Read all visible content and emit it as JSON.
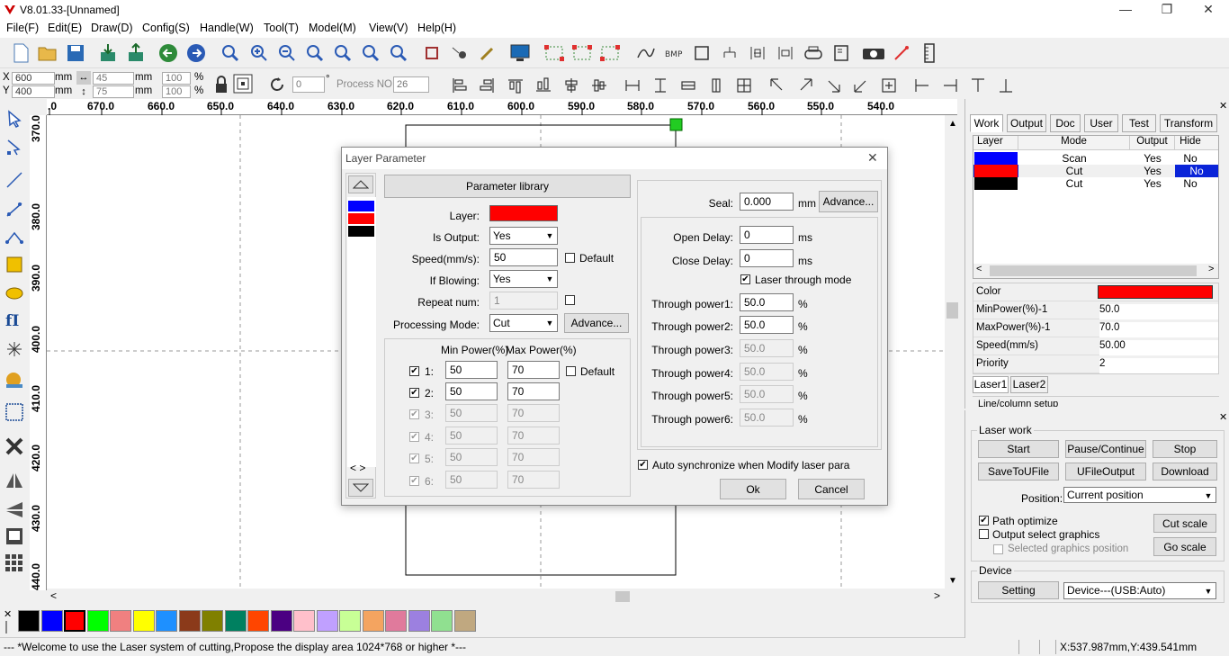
{
  "window": {
    "title": "V8.01.33-[Unnamed]",
    "min": "—",
    "max": "❐",
    "close": "✕"
  },
  "menu": [
    "File(F)",
    "Edit(E)",
    "Draw(D)",
    "Config(S)",
    "Handle(W)",
    "Tool(T)",
    "Model(M)",
    "View(V)",
    "Help(H)"
  ],
  "props": {
    "x": "600",
    "y": "400",
    "w": "45",
    "h": "75",
    "unit": "mm",
    "pw": "100",
    "ph": "100",
    "pct": "%",
    "rot": "0",
    "deg": "°",
    "procno_label": "Process NO:",
    "procno": "26"
  },
  "ruler_top": [
    "670.0",
    "660.0",
    "650.0",
    "640.0",
    "630.0",
    "620.0",
    "610.0",
    "600.0",
    "590.0",
    "580.0",
    "570.0",
    "560.0",
    "550.0",
    "540.0"
  ],
  "ruler_top_first": ".0",
  "ruler_left": [
    "370.0",
    "380.0",
    "390.0",
    "400.0",
    "410.0",
    "420.0",
    "430.0",
    "440.0"
  ],
  "palette": [
    "#000000",
    "#0000ff",
    "#ff0000",
    "#00ff00",
    "#f08080",
    "#ffff00",
    "#1e90ff",
    "#8b3a1a",
    "#808000",
    "#008060",
    "#ff4500",
    "#4b0082",
    "#ffc0cb",
    "#c0a0ff",
    "#c8ff96",
    "#f4a460",
    "#e07a9c",
    "#9c80e0",
    "#90e090",
    "#c0a880"
  ],
  "status": {
    "message": "--- *Welcome to use the Laser system of cutting,Propose the display area 1024*768 or higher *---",
    "coords": "X:537.987mm,Y:439.541mm"
  },
  "rpanel": {
    "tabs": [
      "Work",
      "Output",
      "Doc",
      "User",
      "Test",
      "Transform"
    ],
    "headers": [
      "Layer",
      "Mode",
      "Output",
      "Hide"
    ],
    "layers": [
      {
        "color": "#0000ff",
        "mode": "Scan",
        "output": "Yes",
        "hide": "No"
      },
      {
        "color": "#ff0000",
        "mode": "Cut",
        "output": "Yes",
        "hide": "No"
      },
      {
        "color": "#000000",
        "mode": "Cut",
        "output": "Yes",
        "hide": "No"
      }
    ],
    "props": [
      {
        "name": "Color",
        "value": ""
      },
      {
        "name": "MinPower(%)-1",
        "value": "50.0"
      },
      {
        "name": "MaxPower(%)-1",
        "value": "70.0"
      },
      {
        "name": "Speed(mm/s)",
        "value": "50.00"
      },
      {
        "name": "Priority",
        "value": "2"
      }
    ],
    "laser_tabs": [
      "Laser1",
      "Laser2"
    ],
    "cut_text": "Line/column setup"
  },
  "laserwork": {
    "title": "Laser work",
    "start": "Start",
    "pause": "Pause/Continue",
    "stop": "Stop",
    "save": "SaveToUFile",
    "ufile": "UFileOutput",
    "download": "Download",
    "position_label": "Position:",
    "position": "Current position",
    "path_opt": "Path optimize",
    "out_sel": "Output select graphics",
    "sel_pos": "Selected graphics position",
    "cut_scale": "Cut scale",
    "go_scale": "Go scale",
    "device_title": "Device",
    "setting": "Setting",
    "device": "Device---(USB:Auto)"
  },
  "dialog": {
    "title": "Layer Parameter",
    "param_lib": "Parameter library",
    "layer_label": "Layer:",
    "is_output_label": "Is Output:",
    "is_output": "Yes",
    "speed_label": "Speed(mm/s):",
    "speed": "50",
    "default": "Default",
    "blowing_label": "If Blowing:",
    "blowing": "Yes",
    "repeat_label": "Repeat num:",
    "repeat": "1",
    "mode_label": "Processing Mode:",
    "mode": "Cut",
    "advance": "Advance...",
    "min_power_h": "Min Power(%)",
    "max_power_h": "Max Power(%)",
    "powers": [
      {
        "n": "1:",
        "min": "50",
        "max": "70"
      },
      {
        "n": "2:",
        "min": "50",
        "max": "70"
      },
      {
        "n": "3:",
        "min": "50",
        "max": "70"
      },
      {
        "n": "4:",
        "min": "50",
        "max": "70"
      },
      {
        "n": "5:",
        "min": "50",
        "max": "70"
      },
      {
        "n": "6:",
        "min": "50",
        "max": "70"
      }
    ],
    "seal_label": "Seal:",
    "seal": "0.000",
    "mm": "mm",
    "ms": "ms",
    "open_delay_label": "Open Delay:",
    "open_delay": "0",
    "close_delay_label": "Close Delay:",
    "close_delay": "0",
    "through_mode": "Laser through mode",
    "through": [
      {
        "label": "Through power1:",
        "value": "50.0"
      },
      {
        "label": "Through power2:",
        "value": "50.0"
      },
      {
        "label": "Through power3:",
        "value": "50.0"
      },
      {
        "label": "Through power4:",
        "value": "50.0"
      },
      {
        "label": "Through power5:",
        "value": "50.0"
      },
      {
        "label": "Through power6:",
        "value": "50.0"
      }
    ],
    "auto_sync": "Auto synchronize when Modify laser para",
    "ok": "Ok",
    "cancel": "Cancel",
    "nav": "< >"
  }
}
